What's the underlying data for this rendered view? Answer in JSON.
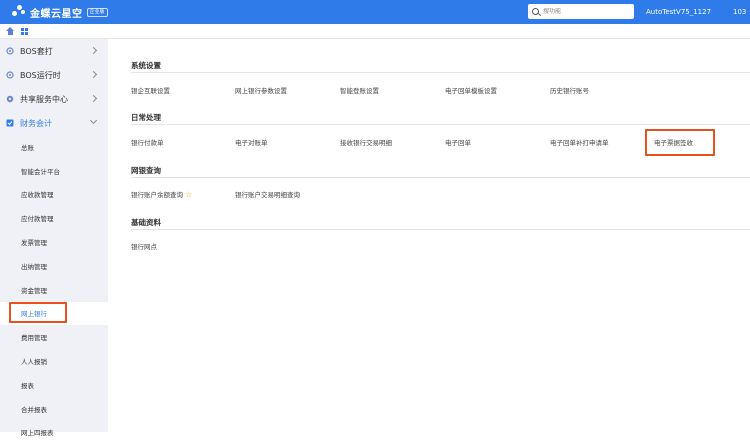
{
  "topbar": {
    "logo_text": "金蝶云星空",
    "logo_badge": "企业版",
    "search_placeholder": "搜功能",
    "username": "AutoTestV75_1127",
    "extra": "103"
  },
  "sidebar": {
    "groups": [
      {
        "label": "BOS套打"
      },
      {
        "label": "BOS运行时"
      },
      {
        "label": "共享服务中心"
      },
      {
        "label": "财务会计"
      }
    ],
    "sub_items": [
      {
        "label": "总账"
      },
      {
        "label": "智能会计平台"
      },
      {
        "label": "应收款管理"
      },
      {
        "label": "应付款管理"
      },
      {
        "label": "发票管理"
      },
      {
        "label": "出纳管理"
      },
      {
        "label": "资金管理"
      },
      {
        "label": "网上银行"
      },
      {
        "label": "费用管理"
      },
      {
        "label": "人人报销"
      },
      {
        "label": "报表"
      },
      {
        "label": "合并报表"
      },
      {
        "label": "网上四报表"
      }
    ]
  },
  "sections": [
    {
      "title": "系统设置",
      "links": [
        "银企互联设置",
        "网上银行参数设置",
        "智能登账设置",
        "电子回单模板设置",
        "历史银行账号"
      ]
    },
    {
      "title": "日常处理",
      "links": [
        "银行付款单",
        "电子对账单",
        "接收银行交易明细",
        "电子回单",
        "电子回单补打申请单",
        "电子票据签收"
      ]
    },
    {
      "title": "网银查询",
      "links": [
        "银行账户余额查询",
        "银行账户交易明细查询"
      ]
    },
    {
      "title": "基础资料",
      "links": [
        "银行网点"
      ]
    }
  ],
  "colors": {
    "accent": "#2f7bea",
    "highlight": "#e8501e",
    "sidebar_bg": "#f0f1f6"
  }
}
